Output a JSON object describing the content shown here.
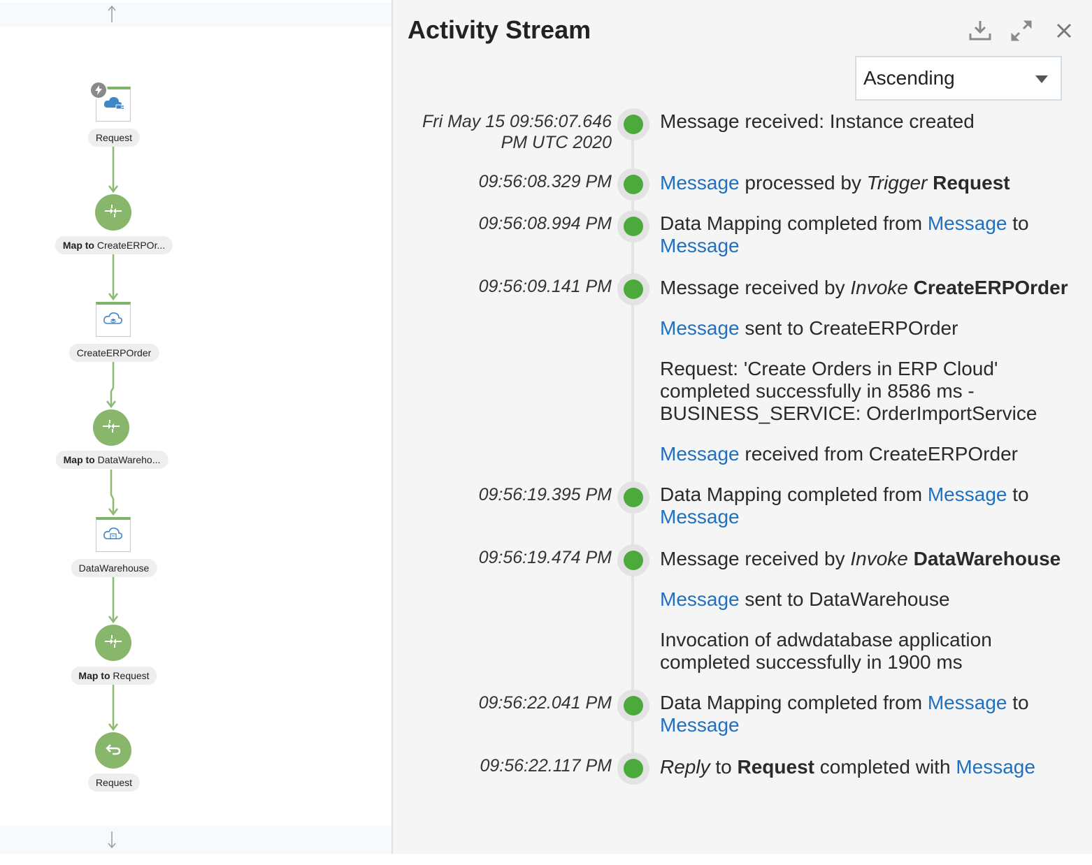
{
  "flow": {
    "nodes": [
      {
        "label": "Request",
        "type": "trigger",
        "icon": "cloud-plug-icon"
      },
      {
        "label_bold": "Map to",
        "label": " CreateERPOr...",
        "type": "map",
        "icon": "map-icon"
      },
      {
        "label": "CreateERPOrder",
        "type": "invoke",
        "icon": "cloud-stack-icon"
      },
      {
        "label_bold": "Map to",
        "label": " DataWareho...",
        "type": "map",
        "icon": "map-icon"
      },
      {
        "label": "DataWarehouse",
        "type": "invoke",
        "icon": "cloud-db-icon"
      },
      {
        "label_bold": "Map to",
        "label": " Request",
        "type": "map",
        "icon": "map-icon"
      },
      {
        "label": "Request",
        "type": "return",
        "icon": "return-icon"
      }
    ],
    "colors": {
      "accent": "#88b76c",
      "line": "#8dba73"
    }
  },
  "panel": {
    "title": "Activity Stream",
    "icons": [
      "download-icon",
      "expand-icon",
      "close-icon"
    ],
    "sort": {
      "value": "Ascending"
    }
  },
  "events": [
    {
      "ts": [
        "Fri May 15 09:56:07.646",
        "PM UTC 2020"
      ],
      "msg": [
        "Message received: Instance created"
      ]
    },
    {
      "ts": [
        "09:56:08.329 PM"
      ],
      "parts": {
        "link": "Message",
        "text1": " processed by ",
        "italic": "Trigger",
        "bold": " Request"
      }
    },
    {
      "ts": [
        "09:56:08.994 PM"
      ],
      "parts": {
        "text1": "Data Mapping completed from ",
        "link1": "Message",
        "text2": " to",
        "link2": "Message"
      }
    },
    {
      "ts": [
        "09:56:09.141 PM"
      ],
      "parts": {
        "text1": "Message received by ",
        "italic": "Invoke",
        "bold": " CreateERPOrder"
      },
      "extra": [
        {
          "link": "Message",
          "text": " sent to CreateERPOrder"
        },
        {
          "text": [
            "Request: 'Create Orders in ERP Cloud'",
            "completed successfully in 8586 ms -",
            "BUSINESS_SERVICE: OrderImportService"
          ]
        },
        {
          "link": "Message",
          "text": " received from CreateERPOrder"
        }
      ]
    },
    {
      "ts": [
        "09:56:19.395 PM"
      ],
      "parts": {
        "text1": "Data Mapping completed from ",
        "link1": "Message",
        "text2": " to",
        "link2": "Message"
      }
    },
    {
      "ts": [
        "09:56:19.474 PM"
      ],
      "parts": {
        "text1": "Message received by ",
        "italic": "Invoke",
        "bold": " DataWarehouse"
      },
      "extra": [
        {
          "link": "Message",
          "text": " sent to DataWarehouse"
        },
        {
          "text": [
            "Invocation of adwdatabase application",
            "completed successfully in 1900 ms"
          ]
        }
      ]
    },
    {
      "ts": [
        "09:56:22.041 PM"
      ],
      "parts": {
        "text1": "Data Mapping completed from ",
        "link1": "Message",
        "text2": " to",
        "link2": "Message"
      }
    },
    {
      "ts": [
        "09:56:22.117 PM"
      ],
      "parts": {
        "italic": "Reply",
        "text1": " to ",
        "bold": "Request",
        "text2": " completed with ",
        "link": "Message"
      }
    }
  ]
}
